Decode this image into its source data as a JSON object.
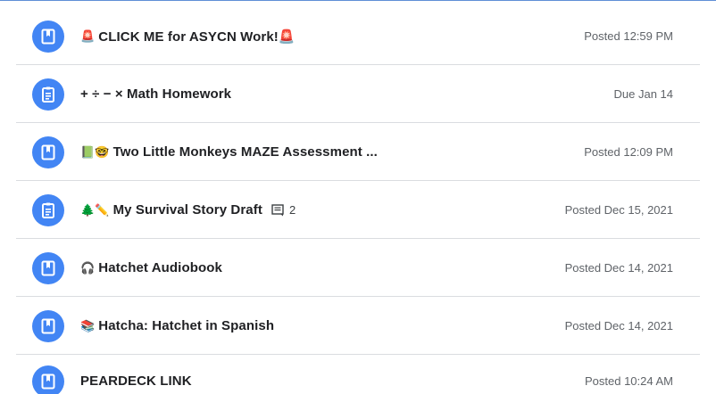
{
  "classwork": {
    "items": [
      {
        "icon": "material-icon",
        "prefix": "🚨",
        "title": "CLICK ME for ASYCN Work!🚨",
        "meta": "Posted 12:59 PM",
        "comments": null
      },
      {
        "icon": "assignment-icon",
        "prefix": "",
        "title": "+ ÷ − × Math Homework",
        "meta": "Due Jan 14",
        "comments": null
      },
      {
        "icon": "material-icon",
        "prefix": "📗🤓",
        "title": "Two Little Monkeys MAZE Assessment ...",
        "meta": "Posted 12:09 PM",
        "comments": null
      },
      {
        "icon": "assignment-icon",
        "prefix": "🌲✏️",
        "title": "My Survival Story Draft",
        "meta": "Posted Dec 15, 2021",
        "comments": "2"
      },
      {
        "icon": "material-icon",
        "prefix": "🎧",
        "title": "Hatchet Audiobook",
        "meta": "Posted Dec 14, 2021",
        "comments": null
      },
      {
        "icon": "material-icon",
        "prefix": "📚",
        "title": "Hatcha: Hatchet in Spanish",
        "meta": "Posted Dec 14, 2021",
        "comments": null
      },
      {
        "icon": "material-icon",
        "prefix": "",
        "title": "PEARDECK LINK",
        "meta": "Posted 10:24 AM",
        "comments": null
      }
    ]
  },
  "colors": {
    "avatar": "#4285f4",
    "divider": "#dadce0",
    "title": "#202124",
    "meta": "#5f6368"
  }
}
